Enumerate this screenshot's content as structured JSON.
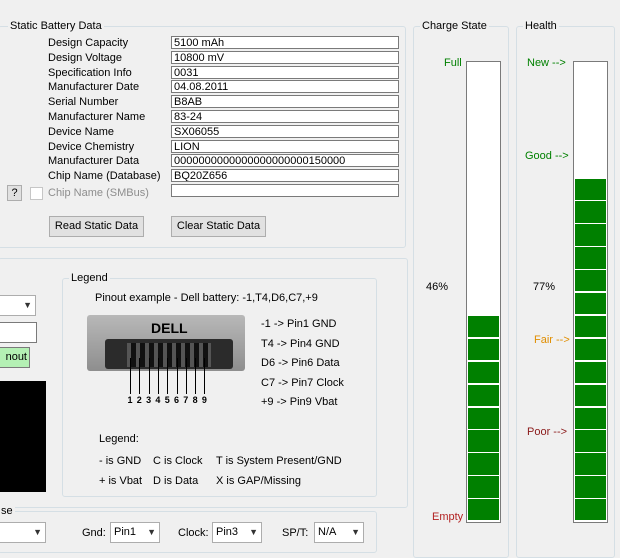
{
  "static_battery": {
    "title": "Static Battery Data",
    "rows": [
      {
        "label": "Design Capacity",
        "value": "5100 mAh"
      },
      {
        "label": "Design Voltage",
        "value": "10800 mV"
      },
      {
        "label": "Specification Info",
        "value": "0031"
      },
      {
        "label": "Manufacturer Date",
        "value": "04.08.2011"
      },
      {
        "label": "Serial Number",
        "value": "B8AB"
      },
      {
        "label": "Manufacturer Name",
        "value": "83-24"
      },
      {
        "label": "Device Name",
        "value": "SX06055"
      },
      {
        "label": "Device Chemistry",
        "value": "LION"
      },
      {
        "label": "Manufacturer Data",
        "value": "0000000000000000000000150000"
      },
      {
        "label": "Chip Name (Database)",
        "value": "BQ20Z656"
      }
    ],
    "smbus_help": "?",
    "smbus_label": "Chip Name (SMBus)",
    "smbus_value": "",
    "read_button": "Read Static Data",
    "clear_button": "Clear Static Data"
  },
  "left_partial": {
    "button_text": "nout",
    "bottom_group_title": "se"
  },
  "legend": {
    "title": "Legend",
    "pinout_example": "Pinout example - Dell battery:  -1,T4,D6,C7,+9",
    "brand": "DELL",
    "pin_numbers": [
      "1",
      "2",
      "3",
      "4",
      "5",
      "6",
      "7",
      "8",
      "9"
    ],
    "mappings": [
      "-1 -> Pin1 GND",
      "T4 -> Pin4 GND",
      "D6 -> Pin6 Data",
      "C7 -> Pin7 Clock",
      "+9 -> Pin9 Vbat"
    ],
    "legend_label": "Legend:",
    "keys_row1": [
      "- is GND",
      "C is Clock",
      "T is System Present/GND"
    ],
    "keys_row2": [
      "+ is Vbat",
      "D is Data",
      "X is GAP/Missing"
    ]
  },
  "pins": {
    "gnd_label": "Gnd:",
    "gnd_value": "Pin1",
    "clock_label": "Clock:",
    "clock_value": "Pin3",
    "spt_label": "SP/T:",
    "spt_value": "N/A"
  },
  "charge_state": {
    "title": "Charge State",
    "full_label": "Full",
    "empty_label": "Empty",
    "percent_text": "46%",
    "level": 0.46,
    "full_color": "#008000",
    "empty_color": "#b22222"
  },
  "health": {
    "title": "Health",
    "new_label": "New -->",
    "good_label": "Good -->",
    "fair_label": "Fair -->",
    "poor_label": "Poor -->",
    "percent_text": "77%",
    "level": 0.77,
    "good_color": "#008000",
    "fair_color": "#e08e00",
    "poor_color": "#8b1a1a"
  }
}
